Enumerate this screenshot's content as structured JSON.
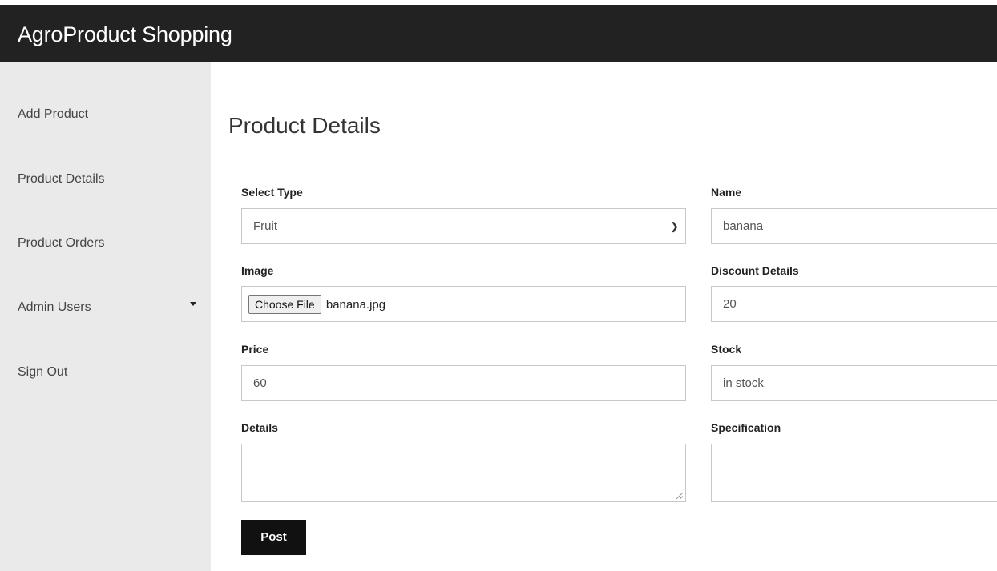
{
  "app": {
    "title": "AgroProduct Shopping"
  },
  "sidebar": {
    "items": [
      {
        "label": "Add Product"
      },
      {
        "label": "Product Details"
      },
      {
        "label": "Product Orders"
      },
      {
        "label": "Admin Users"
      },
      {
        "label": "Sign Out"
      }
    ]
  },
  "page": {
    "title": "Product Details"
  },
  "form": {
    "select_type": {
      "label": "Select Type",
      "value": "Fruit"
    },
    "name": {
      "label": "Name",
      "value": "banana"
    },
    "image": {
      "label": "Image",
      "button": "Choose File",
      "file": "banana.jpg"
    },
    "discount": {
      "label": "Discount Details",
      "value": "20"
    },
    "price": {
      "label": "Price",
      "value": "60"
    },
    "stock": {
      "label": "Stock",
      "value": "in stock"
    },
    "details": {
      "label": "Details",
      "value": ""
    },
    "specification": {
      "label": "Specification",
      "value": ""
    },
    "submit": {
      "label": "Post"
    }
  },
  "icons": {
    "select_arrow": "chevron-down-icon",
    "dropdown_caret": "caret-down-icon"
  },
  "colors": {
    "navbar_bg": "#222222",
    "sidebar_bg": "#eaeaea",
    "post_button_bg": "#111111"
  }
}
